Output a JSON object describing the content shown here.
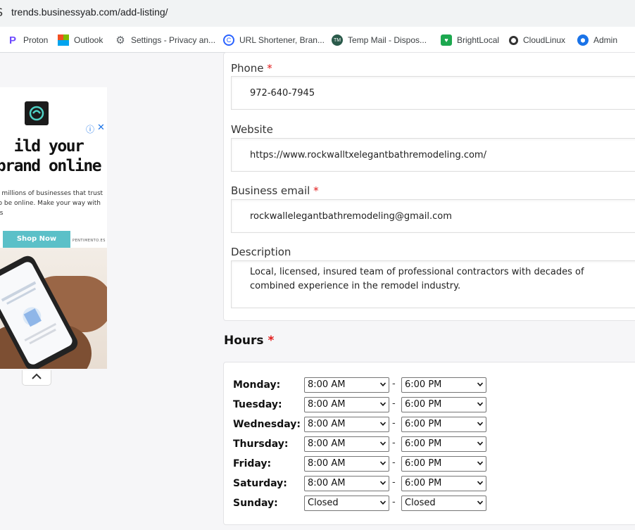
{
  "browser": {
    "url": "trends.businessyab.com/add-listing/",
    "bookmarks": [
      {
        "label": "Proton",
        "icon": "proton-icon",
        "color": "#6d4aff"
      },
      {
        "label": "Outlook",
        "icon": "windows-icon",
        "color": "#f25022"
      },
      {
        "label": "Settings - Privacy an...",
        "icon": "gear-icon",
        "color": "#5f6368"
      },
      {
        "label": "URL Shortener, Bran...",
        "icon": "link-icon",
        "color": "#2962ff"
      },
      {
        "label": "Temp Mail - Dispos...",
        "icon": "tempmail-icon",
        "color": "#2a5a4a"
      },
      {
        "label": "BrightLocal",
        "icon": "brightlocal-icon",
        "color": "#1ca84f"
      },
      {
        "label": "CloudLinux",
        "icon": "cloudlinux-icon",
        "color": "#333333"
      },
      {
        "label": "Admin",
        "icon": "admin-icon",
        "color": "#1a73e8"
      }
    ]
  },
  "ad": {
    "title": "ild your brand online",
    "subtitle": "e millions of businesses that trust to be online. Make your way with us",
    "button": "Shop Now",
    "brand": "PENTIMENTO.ES",
    "info_icon": "ⓘ",
    "close_icon": "✕",
    "collapse_icon": "chevron-up-icon"
  },
  "form": {
    "phone": {
      "label": "Phone",
      "required": "*",
      "value": "972-640-7945"
    },
    "website": {
      "label": "Website",
      "value": "https://www.rockwalltxelegantbathremodeling.com/"
    },
    "email": {
      "label": "Business email",
      "required": "*",
      "value": "rockwallelegantbathremodeling@gmail.com"
    },
    "description": {
      "label": "Description",
      "value": "Local, licensed, insured team of professional contractors with decades of combined experience in the remodel industry."
    }
  },
  "hours": {
    "title": "Hours",
    "required": "*",
    "separator": "-",
    "days": [
      {
        "day": "Monday:",
        "open": "8:00 AM",
        "close": "6:00 PM"
      },
      {
        "day": "Tuesday:",
        "open": "8:00 AM",
        "close": "6:00 PM"
      },
      {
        "day": "Wednesday:",
        "open": "8:00 AM",
        "close": "6:00 PM"
      },
      {
        "day": "Thursday:",
        "open": "8:00 AM",
        "close": "6:00 PM"
      },
      {
        "day": "Friday:",
        "open": "8:00 AM",
        "close": "6:00 PM"
      },
      {
        "day": "Saturday:",
        "open": "8:00 AM",
        "close": "6:00 PM"
      },
      {
        "day": "Sunday:",
        "open": "Closed",
        "close": "Closed"
      }
    ]
  }
}
